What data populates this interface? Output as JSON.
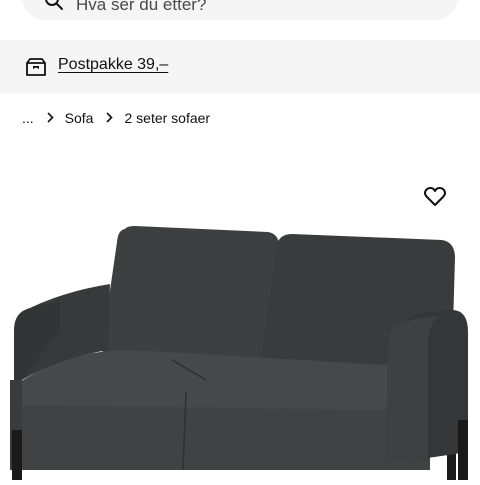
{
  "search": {
    "placeholder": "Hva ser du etter?",
    "icon": "search-icon"
  },
  "shipping": {
    "icon": "package-box-icon",
    "label": "Postpakke 39,–"
  },
  "breadcrumb": {
    "ellipsis": "...",
    "items": [
      "Sofa",
      "2 seter sofaer"
    ],
    "separator_icon": "chevron-right-icon"
  },
  "product": {
    "image_subject": "dark grey 2-seat sofa",
    "favourite_icon": "heart-icon"
  },
  "colors": {
    "banner_bg": "#f5f5f5",
    "text": "#111111",
    "sofa_fabric": "#3b3c3e",
    "sofa_legs": "#1a1a1a"
  }
}
